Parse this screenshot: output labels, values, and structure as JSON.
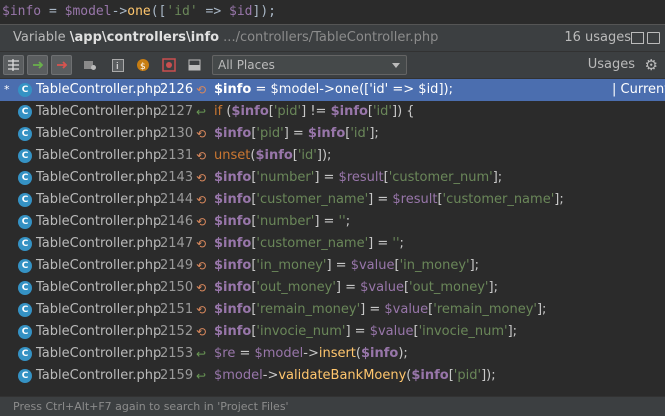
{
  "editor_line": {
    "parts": [
      "$info",
      " = ",
      "$model",
      "->",
      "one",
      "([",
      "'id'",
      " => ",
      "$id",
      "]);"
    ]
  },
  "header": {
    "prefix": "Variable ",
    "name": "\\app\\controllers\\info",
    "path": " .../controllers/TableController.php",
    "usages": "16 usages"
  },
  "toolbar": {
    "scope": "All Places",
    "usages_label": "Usages"
  },
  "rows": [
    {
      "star": "*",
      "file": "TableController.php",
      "line": "2126",
      "access": "write",
      "code": "$info = $model->one(['id' => $id]);",
      "current": "| Current"
    },
    {
      "file": "TableController.php",
      "line": "2127",
      "access": "read",
      "code": "if ($info['pid'] != $info['id']) {"
    },
    {
      "file": "TableController.php",
      "line": "2130",
      "access": "write",
      "code": "$info['pid'] = $info['id'];"
    },
    {
      "file": "TableController.php",
      "line": "2131",
      "access": "write",
      "code": "unset($info['id']);"
    },
    {
      "file": "TableController.php",
      "line": "2143",
      "access": "write",
      "code": "$info['number'] = $result['customer_num'];"
    },
    {
      "file": "TableController.php",
      "line": "2144",
      "access": "write",
      "code": "$info['customer_name'] = $result['customer_name'];"
    },
    {
      "file": "TableController.php",
      "line": "2146",
      "access": "write",
      "code": "$info['number'] = '';"
    },
    {
      "file": "TableController.php",
      "line": "2147",
      "access": "write",
      "code": "$info['customer_name'] = '';"
    },
    {
      "file": "TableController.php",
      "line": "2149",
      "access": "write",
      "code": "$info['in_money'] = $value['in_money'];"
    },
    {
      "file": "TableController.php",
      "line": "2150",
      "access": "write",
      "code": "$info['out_money'] = $value['out_money'];"
    },
    {
      "file": "TableController.php",
      "line": "2151",
      "access": "write",
      "code": "$info['remain_money'] = $value['remain_money'];"
    },
    {
      "file": "TableController.php",
      "line": "2152",
      "access": "write",
      "code": "$info['invocie_num'] = $value['invocie_num'];"
    },
    {
      "file": "TableController.php",
      "line": "2153",
      "access": "read",
      "code": "$re = $model->insert($info);"
    },
    {
      "file": "TableController.php",
      "line": "2159",
      "access": "read",
      "code": "$model->validateBankMoeny($info['pid']);"
    }
  ],
  "status": {
    "text": "Press Ctrl+Alt+F7 again to search in 'Project Files'"
  },
  "colors": {
    "selection": "#4b6eaf",
    "panel": "#3c3f41",
    "background": "#2b2b2b",
    "variable": "#9876aa",
    "string": "#6a8759"
  },
  "icons": [
    "merge-icon",
    "navigate-icon",
    "exclude-icon",
    "filter-icon",
    "info-icon",
    "php-icon",
    "record-icon",
    "preview-icon",
    "gear-icon",
    "pin-icon",
    "previous-icon"
  ]
}
